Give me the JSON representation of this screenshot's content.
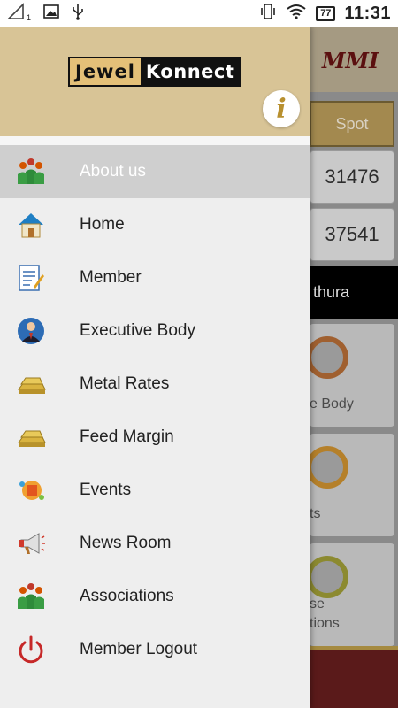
{
  "status_bar": {
    "sim_indicator": "1",
    "battery": "77",
    "time": "11:31"
  },
  "background_app": {
    "logo": "MMI",
    "tab": "Spot",
    "rates": [
      "31476",
      "37541"
    ],
    "city": "thura",
    "cards": [
      "e Body",
      "ts",
      "se\ntions"
    ]
  },
  "drawer": {
    "brand_left": "Jewel",
    "brand_right": "Konnect",
    "info_icon": "i",
    "items": [
      {
        "label": "About us",
        "icon": "group-icon",
        "active": true
      },
      {
        "label": "Home",
        "icon": "home-icon",
        "active": false
      },
      {
        "label": "Member",
        "icon": "member-form-icon",
        "active": false
      },
      {
        "label": "Executive Body",
        "icon": "executive-person-icon",
        "active": false
      },
      {
        "label": "Metal Rates",
        "icon": "gold-bar-icon",
        "active": false
      },
      {
        "label": "Feed Margin",
        "icon": "gold-bar-icon",
        "active": false
      },
      {
        "label": "Events",
        "icon": "events-icon",
        "active": false
      },
      {
        "label": "News Room",
        "icon": "megaphone-icon",
        "active": false
      },
      {
        "label": "Associations",
        "icon": "group-icon",
        "active": false
      },
      {
        "label": "Member Logout",
        "icon": "power-icon",
        "active": false
      }
    ]
  }
}
